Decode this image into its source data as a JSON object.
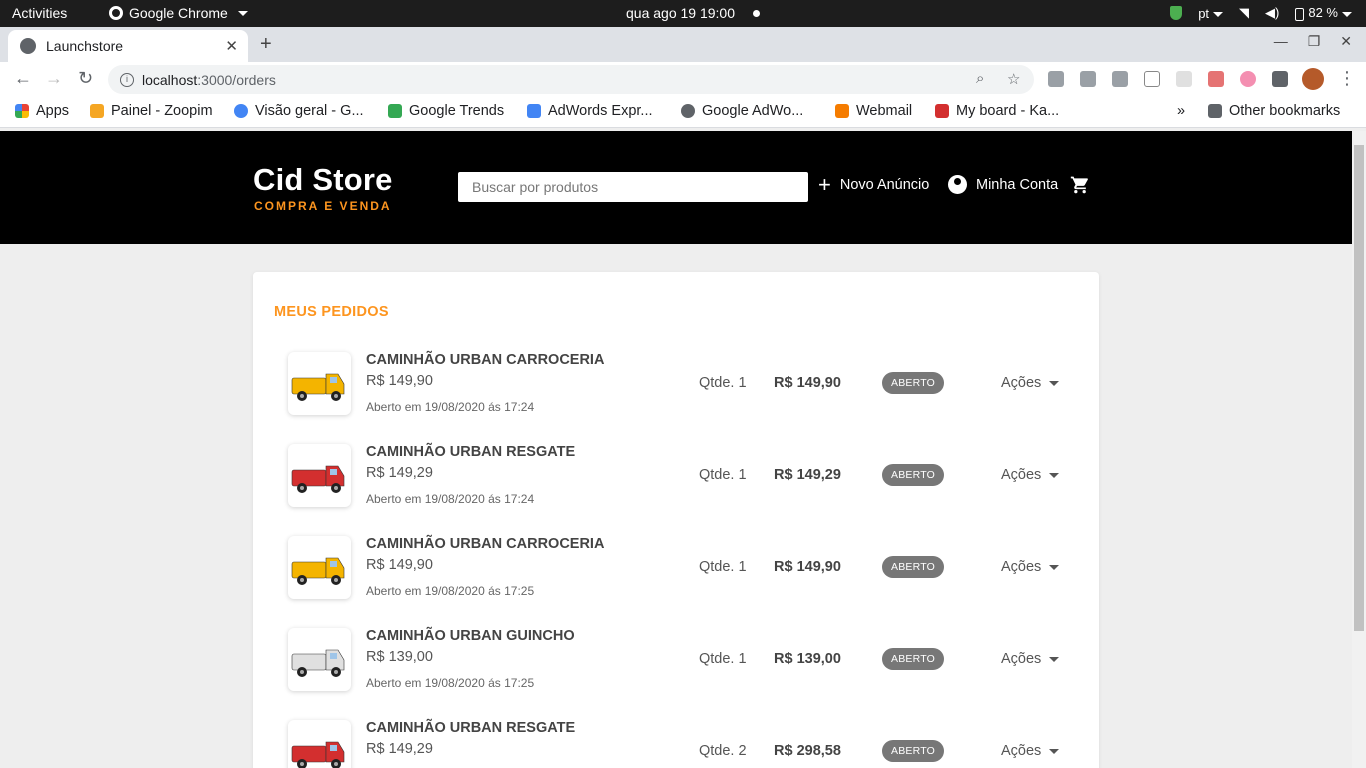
{
  "os": {
    "activities": "Activities",
    "app_name": "Google Chrome",
    "clock": "qua ago 19  19:00",
    "lang": "pt",
    "battery": "82 %"
  },
  "browser": {
    "tab_title": "Launchstore",
    "url_host": "localhost",
    "url_path": ":3000/orders",
    "bookmarks": [
      {
        "label": "Apps",
        "color": "#ea4335"
      },
      {
        "label": "Painel - Zoopim",
        "color": "#f5a623"
      },
      {
        "label": "Visão geral - G...",
        "color": "#4285f4"
      },
      {
        "label": "Google Trends",
        "color": "#34a853"
      },
      {
        "label": "AdWords Expr...",
        "color": "#4285f4"
      },
      {
        "label": "Google AdWo...",
        "color": "#5f6368"
      },
      {
        "label": "Webmail",
        "color": "#f57c00"
      },
      {
        "label": "My board - Ka...",
        "color": "#d32f2f"
      }
    ],
    "more_bookmarks": "»",
    "other_bookmarks": "Other bookmarks"
  },
  "header": {
    "store_name": "Cid Store",
    "tagline": "COMPRA E VENDA",
    "search_placeholder": "Buscar por produtos",
    "new_ad": "Novo Anúncio",
    "account": "Minha Conta"
  },
  "orders_section": {
    "heading": "MEUS PEDIDOS",
    "orders": [
      {
        "title": "CAMINHÃO URBAN CARROCERIA",
        "price": "R$ 149,90",
        "opened": "Aberto em 19/08/2020 ás 17:24",
        "qty": "Qtde. 1",
        "total": "R$ 149,90",
        "status": "ABERTO",
        "actions": "Ações",
        "truck_color": "#f4b400"
      },
      {
        "title": "CAMINHÃO URBAN RESGATE",
        "price": "R$ 149,29",
        "opened": "Aberto em 19/08/2020 ás 17:24",
        "qty": "Qtde. 1",
        "total": "R$ 149,29",
        "status": "ABERTO",
        "actions": "Ações",
        "truck_color": "#d32f2f"
      },
      {
        "title": "CAMINHÃO URBAN CARROCERIA",
        "price": "R$ 149,90",
        "opened": "Aberto em 19/08/2020 ás 17:25",
        "qty": "Qtde. 1",
        "total": "R$ 149,90",
        "status": "ABERTO",
        "actions": "Ações",
        "truck_color": "#f4b400"
      },
      {
        "title": "CAMINHÃO URBAN GUINCHO",
        "price": "R$ 139,00",
        "opened": "Aberto em 19/08/2020 ás 17:25",
        "qty": "Qtde. 1",
        "total": "R$ 139,00",
        "status": "ABERTO",
        "actions": "Ações",
        "truck_color": "#e0e0e0"
      },
      {
        "title": "CAMINHÃO URBAN RESGATE",
        "price": "R$ 149,29",
        "opened": "",
        "qty": "Qtde. 2",
        "total": "R$ 298,58",
        "status": "ABERTO",
        "actions": "Ações",
        "truck_color": "#d32f2f"
      }
    ]
  },
  "colors": {
    "accent": "#fd951f",
    "header_bg": "#000000",
    "badge_bg": "#777777"
  }
}
